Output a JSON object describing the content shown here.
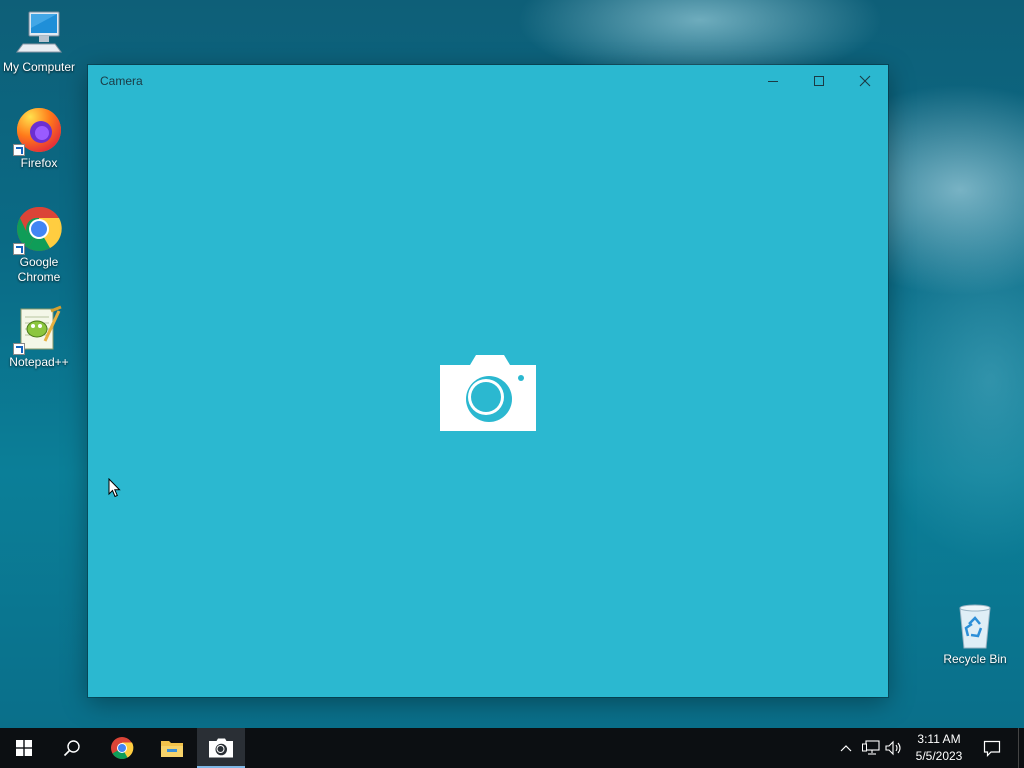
{
  "desktop": {
    "icons": [
      {
        "label": "My Computer",
        "icon": "computer-icon"
      },
      {
        "label": "Firefox",
        "icon": "firefox-icon"
      },
      {
        "label": "Google Chrome",
        "icon": "chrome-icon"
      },
      {
        "label": "Notepad++",
        "icon": "notepadpp-icon"
      },
      {
        "label": "Recycle Bin",
        "icon": "recycle-bin-icon"
      }
    ],
    "wallpaper_color": "#0a6b86"
  },
  "window": {
    "title": "Camera",
    "background": "#2bb8d0",
    "center_icon": "camera-icon",
    "buttons": {
      "minimize": "minimize-icon",
      "maximize": "maximize-icon",
      "close": "close-icon"
    }
  },
  "taskbar": {
    "pinned": [
      "start-icon",
      "search-icon",
      "chrome-icon",
      "file-explorer-icon",
      "camera-icon"
    ],
    "active_app": "Camera",
    "tray": [
      "chevron-up-icon",
      "network-icon",
      "volume-icon"
    ],
    "time": "3:11 AM",
    "date": "5/5/2023",
    "notification_icon": "action-center-icon"
  }
}
